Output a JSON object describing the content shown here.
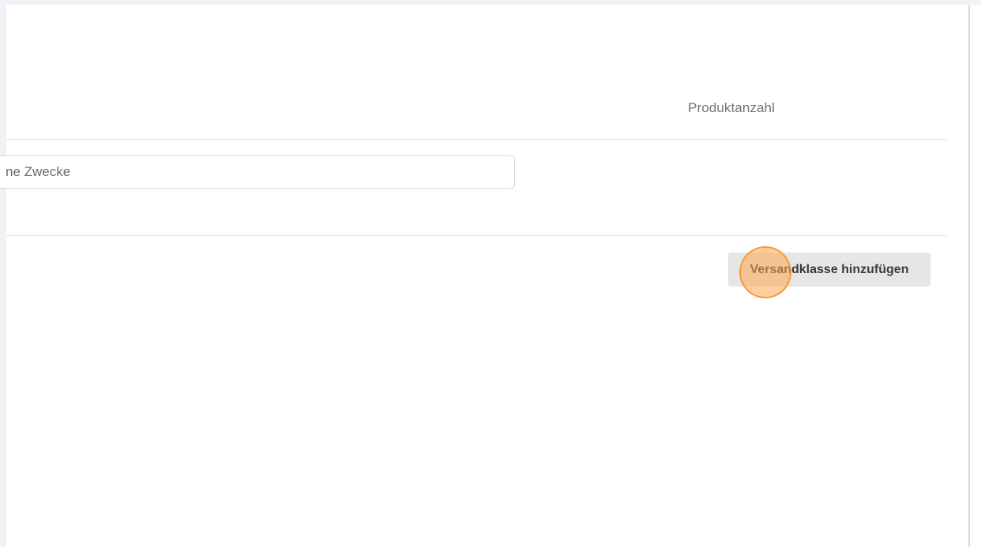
{
  "table": {
    "column_header": "Produktanzahl"
  },
  "row": {
    "description_value": "ne Zwecke"
  },
  "actions": {
    "add_shipping_class_label": "Versandklasse hinzufügen"
  },
  "colors": {
    "accent_marker": "#ffa64d",
    "button_bg": "#e6e6e6",
    "page_bg": "#f0f2f6"
  }
}
